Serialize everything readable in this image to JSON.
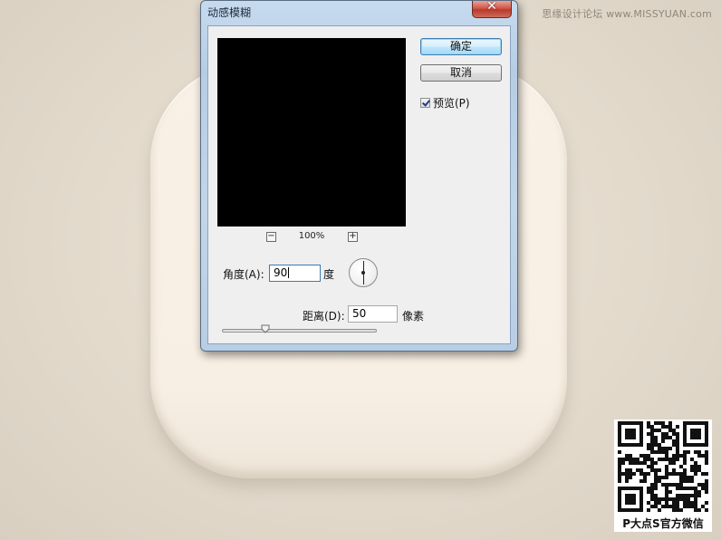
{
  "watermark": "思缘设计论坛 www.MISSYUAN.com",
  "dialog": {
    "title": "动感模糊",
    "close_glyph": "✕",
    "ok_label": "确定",
    "cancel_label": "取消",
    "preview_checkbox": {
      "label": "预览(P)",
      "checked": true
    },
    "zoom": {
      "minus": "−",
      "plus": "+",
      "level": "100%"
    },
    "angle": {
      "label": "角度(A):",
      "value": "90",
      "unit": "度"
    },
    "distance": {
      "label": "距离(D):",
      "value": "50",
      "unit": "像素",
      "slider_fraction": 0.28
    }
  },
  "qr": {
    "caption": "P大点S官方微信"
  },
  "colors": {
    "background": "#e3dacc",
    "tile": "#f7efe3",
    "dialog_frame": "#b6cde4",
    "close_button": "#c84a3c",
    "default_button": "#bee6fd"
  },
  "icons": {
    "close": "close-icon",
    "zoom_out": "zoom-out-icon",
    "zoom_in": "zoom-in-icon",
    "angle_dial": "angle-dial-icon",
    "checkbox": "checkmark-icon"
  }
}
